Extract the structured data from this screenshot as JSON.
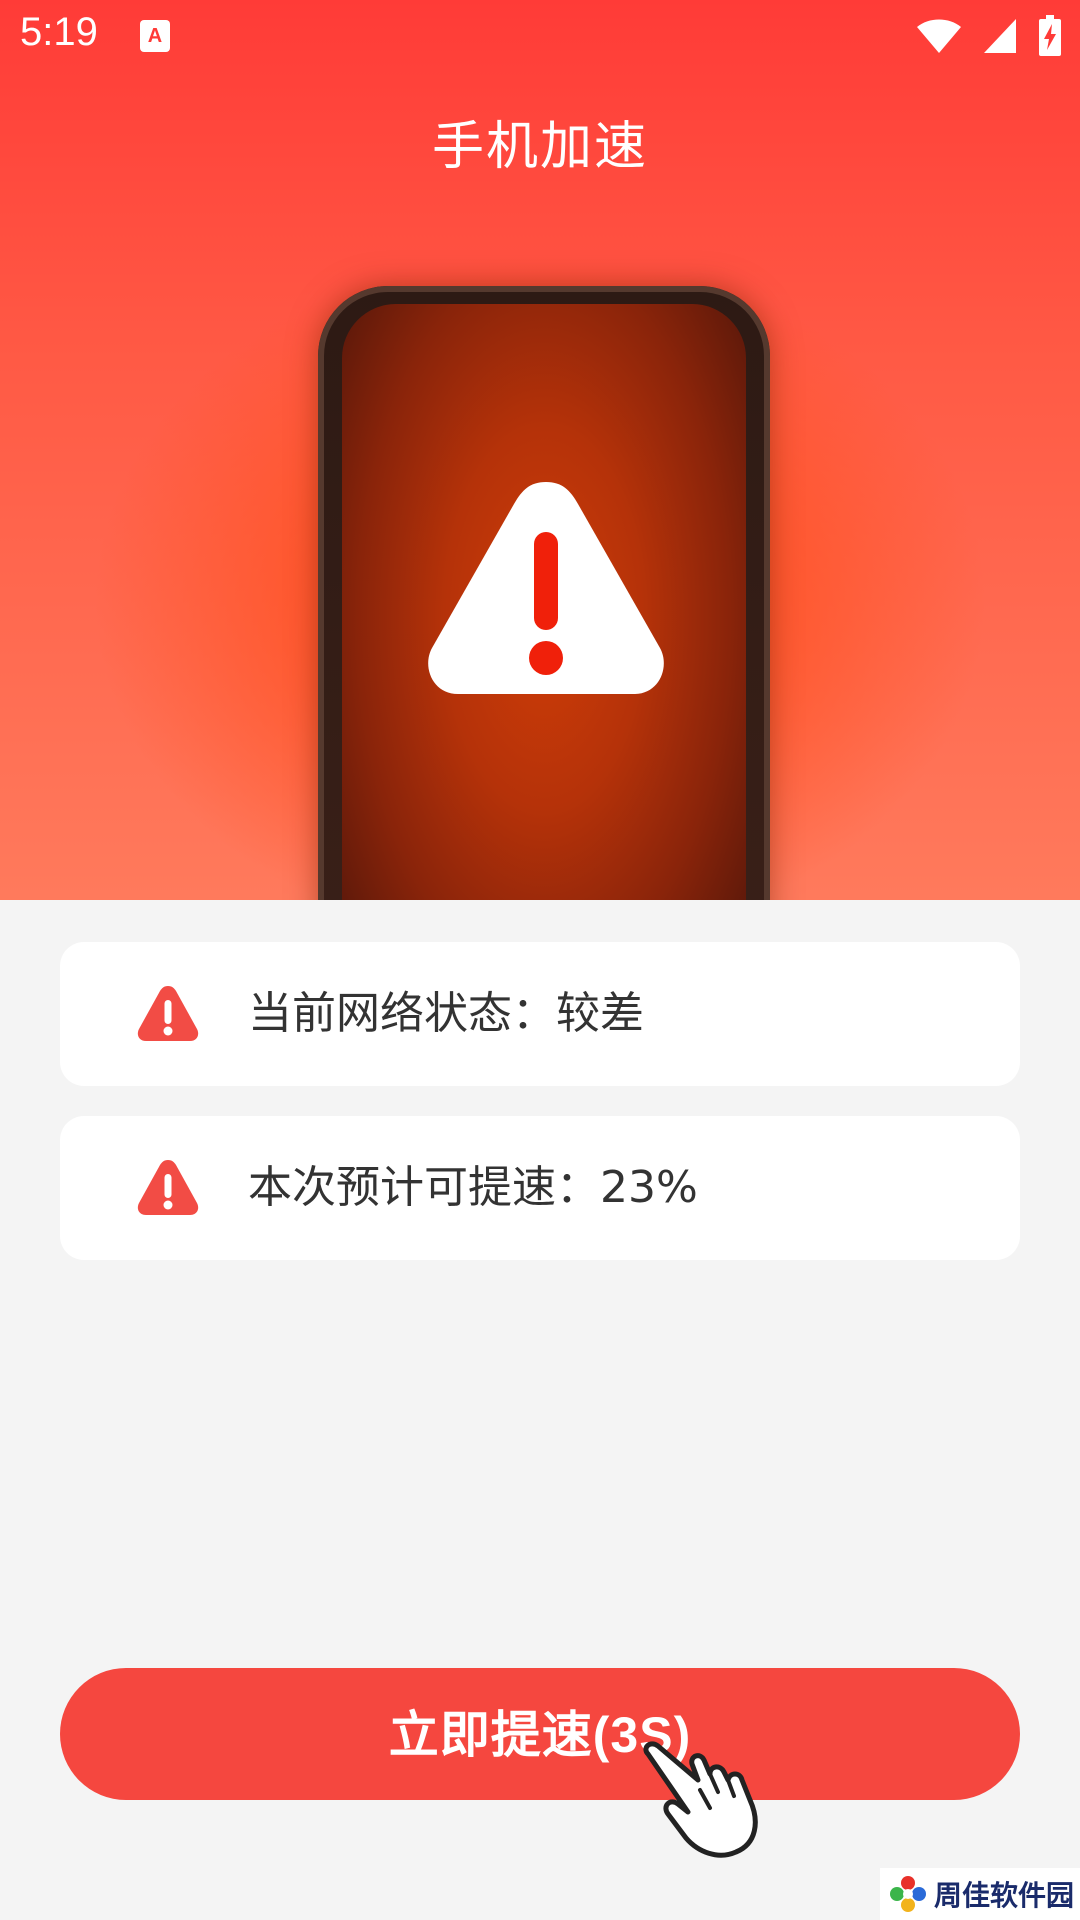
{
  "status_bar": {
    "time": "5:19",
    "app_icon_letter": "A"
  },
  "header": {
    "title": "手机加速"
  },
  "cards": [
    {
      "text": "当前网络状态：较差",
      "icon": "warning-triangle-icon"
    },
    {
      "text": "本次预计可提速：23%",
      "icon": "warning-triangle-icon"
    }
  ],
  "cta": {
    "label": "立即提速(3S)"
  },
  "watermark": {
    "text": "周佳软件园"
  },
  "colors": {
    "accent": "#f5473f",
    "header_top": "#ff3b37",
    "card_bg": "#ffffff",
    "page_bg": "#f4f4f4",
    "text": "#333333"
  }
}
